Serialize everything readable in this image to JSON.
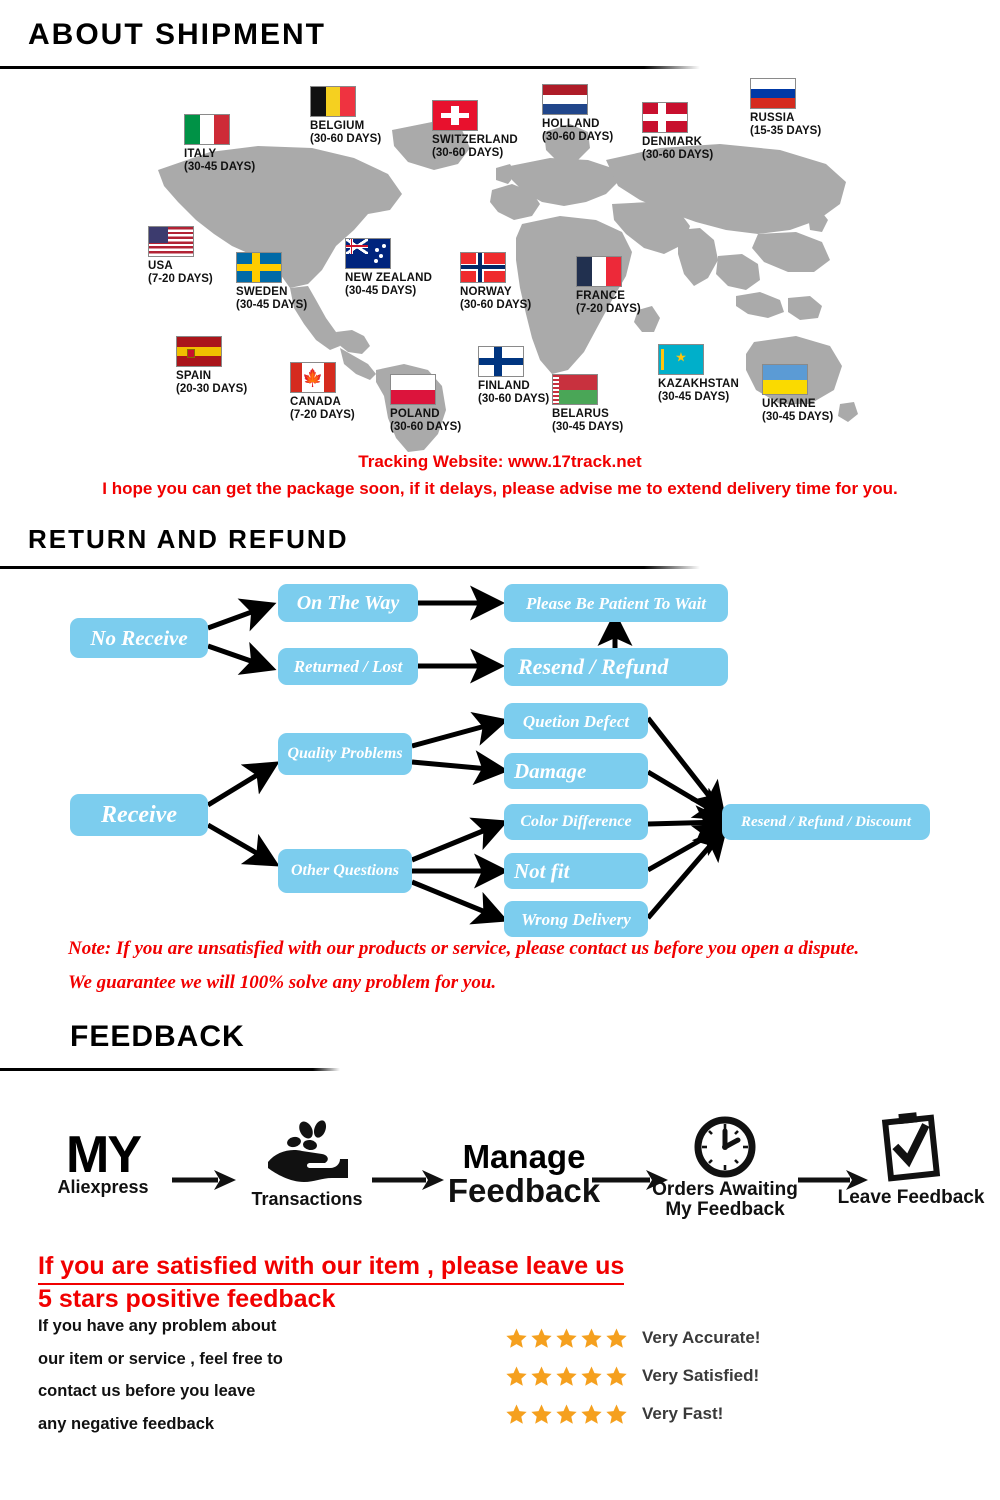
{
  "sections": {
    "shipment": {
      "heading": "ABOUT  SHIPMENT"
    },
    "return": {
      "heading": "RETURN  AND  REFUND"
    },
    "feedback": {
      "heading": "FEEDBACK"
    }
  },
  "shipment": {
    "tracking_text": "Tracking Website: www.17track.net",
    "delay_note": "I hope you can get the package soon, if it delays, please advise me to extend delivery time for you.",
    "countries": [
      {
        "name": "ITALY",
        "days": "(30-45 DAYS)",
        "flag": "flag-italy"
      },
      {
        "name": "BELGIUM",
        "days": "(30-60 DAYS)",
        "flag": "flag-belgium"
      },
      {
        "name": "SWITZERLAND",
        "days": "(30-60 DAYS)",
        "flag": "flag-switzerland"
      },
      {
        "name": "HOLLAND",
        "days": "(30-60 DAYS)",
        "flag": "flag-holland"
      },
      {
        "name": "DENMARK",
        "days": "(30-60 DAYS)",
        "flag": "flag-denmark"
      },
      {
        "name": "RUSSIA",
        "days": "(15-35 DAYS)",
        "flag": "flag-russia"
      },
      {
        "name": "USA",
        "days": "(7-20 DAYS)",
        "flag": "flag-usa"
      },
      {
        "name": "SWEDEN",
        "days": "(30-45 DAYS)",
        "flag": "flag-sweden"
      },
      {
        "name": "NEW ZEALAND",
        "days": "(30-45 DAYS)",
        "flag": "flag-new-zealand"
      },
      {
        "name": "NORWAY",
        "days": "(30-60 DAYS)",
        "flag": "flag-norway"
      },
      {
        "name": "FRANCE",
        "days": "(7-20 DAYS)",
        "flag": "flag-france"
      },
      {
        "name": "SPAIN",
        "days": "(20-30 DAYS)",
        "flag": "flag-spain"
      },
      {
        "name": "CANADA",
        "days": "(7-20 DAYS)",
        "flag": "flag-canada"
      },
      {
        "name": "POLAND",
        "days": "(30-60 DAYS)",
        "flag": "flag-poland"
      },
      {
        "name": "FINLAND",
        "days": "(30-60 DAYS)",
        "flag": "flag-finland"
      },
      {
        "name": "BELARUS",
        "days": "(30-45 DAYS)",
        "flag": "flag-belarus"
      },
      {
        "name": "KAZAKHSTAN",
        "days": "(30-45 DAYS)",
        "flag": "flag-kazakhstan"
      },
      {
        "name": "UKRAINE",
        "days": "(30-45 DAYS)",
        "flag": "flag-ukraine"
      }
    ]
  },
  "flowchart": {
    "nodes": {
      "no_receive": "No Receive",
      "on_the_way": "On The Way",
      "returned_lost": "Returned / Lost",
      "be_patient": "Please Be Patient To Wait",
      "resend_refund": "Resend / Refund",
      "receive": "Receive",
      "quality_problems": "Quality Problems",
      "other_questions": "Other Questions",
      "quetion_defect": "Quetion Defect",
      "damage": "Damage",
      "color_difference": "Color Difference",
      "not_fit": "Not fit",
      "wrong_delivery": "Wrong Delivery",
      "resend_refund_discount": "Resend / Refund / Discount"
    },
    "note_line_1": "Note: If you are unsatisfied with our products or service, please contact us before you open a dispute.",
    "note_line_2": "We guarantee we will 100% solve any problem for you."
  },
  "feedback": {
    "steps": [
      {
        "caption_top": "MY",
        "caption": "Aliexpress",
        "icon": "my-aliexpress-wordmark"
      },
      {
        "caption_top": "",
        "caption": "Transactions",
        "icon": "hand-coins-icon"
      },
      {
        "caption_top": "Manage",
        "caption": "Feedback",
        "icon": "manage-feedback-wordmark"
      },
      {
        "caption_top": "",
        "caption": "Orders Awaiting\nMy Feedback",
        "icon": "clock-icon"
      },
      {
        "caption_top": "",
        "caption": "Leave Feedback",
        "icon": "clipboard-check-icon"
      }
    ],
    "cta_line_1": "If you are satisfied with our item , please leave us",
    "cta_line_2": "5 stars positive feedback",
    "blurb": [
      "If you have any problem about",
      "our item or service , feel free to",
      "contact us before you  leave",
      "any negative feedback"
    ],
    "ratings": [
      {
        "stars": 5,
        "label": "Very Accurate!"
      },
      {
        "stars": 5,
        "label": "Very Satisfied!"
      },
      {
        "stars": 5,
        "label": "Very Fast!"
      }
    ]
  },
  "colors": {
    "red": "#f10000",
    "node_blue": "#7ccdee",
    "star_orange": "#f5a01e",
    "map_gray": "#aaaaaa"
  }
}
